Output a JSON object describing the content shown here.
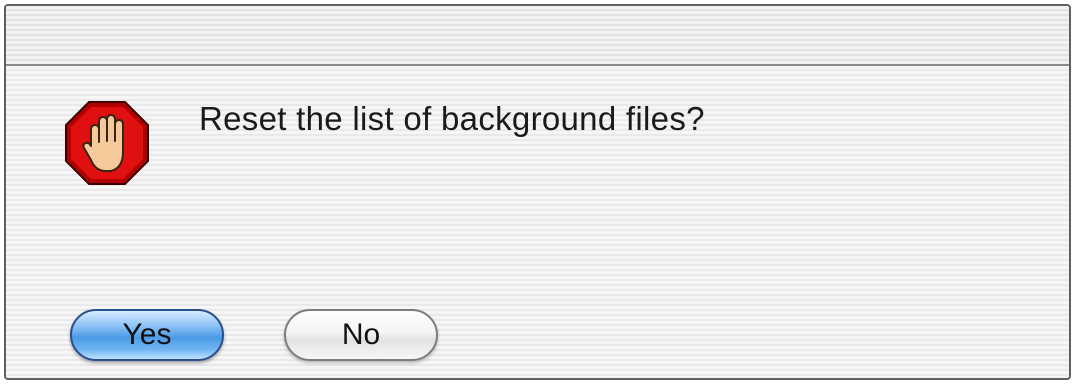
{
  "dialog": {
    "message": "Reset the list of background files?",
    "icon": "stop-hand-icon",
    "buttons": {
      "yes_label": "Yes",
      "no_label": "No"
    }
  },
  "colors": {
    "default_button": "#4d9be6",
    "stop_sign": "#d40000",
    "hand": "#f5c99a"
  }
}
